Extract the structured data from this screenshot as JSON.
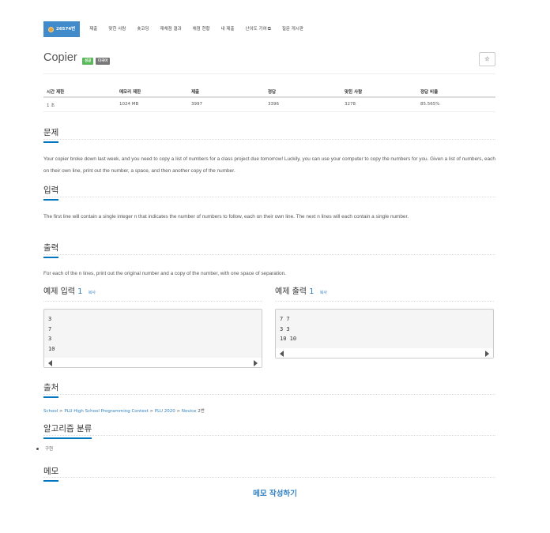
{
  "nav": {
    "items": [
      {
        "label": "26574번",
        "active": true
      },
      {
        "label": "제출"
      },
      {
        "label": "맞힌 사람"
      },
      {
        "label": "숏코딩"
      },
      {
        "label": "재채점 결과"
      },
      {
        "label": "채점 현황"
      },
      {
        "label": "내 제출"
      },
      {
        "label": "난이도 기여"
      },
      {
        "label": "질문 게시판"
      }
    ]
  },
  "problem": {
    "title": "Copier",
    "badge_success": "성공",
    "badge_multi": "다국어",
    "star": "☆"
  },
  "stats": {
    "headers": [
      "시간 제한",
      "메모리 제한",
      "제출",
      "정답",
      "맞힌 사람",
      "정답 비율"
    ],
    "values": [
      "1 초",
      "1024 MB",
      "3997",
      "3396",
      "3278",
      "85.565%"
    ]
  },
  "sections": {
    "description": {
      "heading": "문제",
      "text": "Your copier broke down last week, and you need to copy a list of numbers for a class project due tomorrow! Luckily, you can use your computer to copy the numbers for you. Given a list of numbers, each on their own line, print out the number, a space, and then another copy of the number."
    },
    "input": {
      "heading": "입력",
      "text": "The first line will contain a single integer n that indicates the number of numbers to follow, each on their own line. The next n lines will each contain a single number."
    },
    "output": {
      "heading": "출력",
      "text": "For each of the n lines, print out the original number and a copy of the number, with one space of separation."
    },
    "source": {
      "heading": "출처",
      "parts": [
        "School",
        " > ",
        "PLU High School Programming Contest",
        " > ",
        "PLU 2020",
        " > ",
        "Novice",
        " 2번"
      ]
    },
    "algorithm": {
      "heading": "알고리즘 분류",
      "items": [
        "구현"
      ]
    },
    "memo": {
      "heading": "메모",
      "link": "메모 작성하기"
    }
  },
  "samples": {
    "input": {
      "label": "예제 입력",
      "number": "1",
      "copy": "복사",
      "lines": [
        "3",
        "7",
        "3",
        "10"
      ]
    },
    "output": {
      "label": "예제 출력",
      "number": "1",
      "copy": "복사",
      "lines": [
        "7 7",
        "3 3",
        "10 10"
      ]
    }
  },
  "colors": {
    "accent": "#428bca",
    "link": "#3383c3",
    "success": "#5cb85c",
    "heading_underline": "#0076c0"
  }
}
